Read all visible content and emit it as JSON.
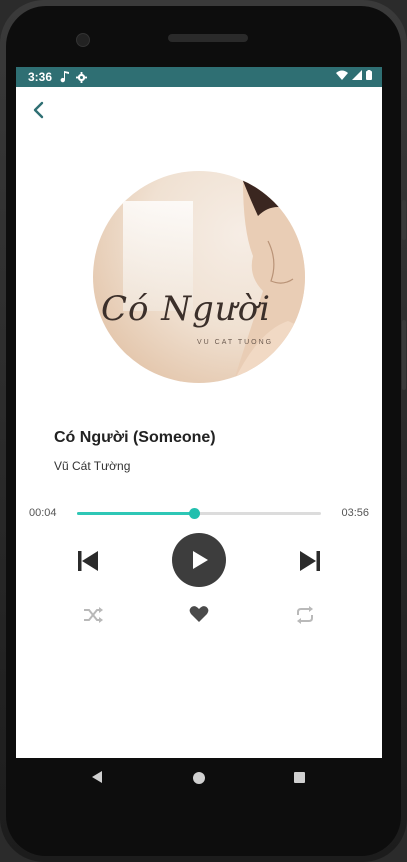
{
  "status_bar": {
    "time": "3:36",
    "left_icons": [
      "music-note-icon",
      "gear-icon"
    ],
    "right_icons": [
      "wifi-icon",
      "signal-icon",
      "battery-icon"
    ],
    "color": "#2f6f73"
  },
  "header": {
    "back_icon": "chevron-left-icon"
  },
  "album": {
    "cover_title": "Có Người",
    "cover_artist": "VU CAT TUONG"
  },
  "song": {
    "title": "Có Người (Someone)",
    "artist": "Vũ Cát Tường"
  },
  "progress": {
    "current": "00:04",
    "total": "03:56",
    "fraction": 0.48,
    "accent_color": "#2ec7b6"
  },
  "controls": {
    "prev_icon": "skip-previous-icon",
    "play_icon": "play-icon",
    "next_icon": "skip-next-icon",
    "shuffle_icon": "shuffle-icon",
    "favorite_icon": "heart-icon",
    "repeat_icon": "repeat-icon"
  },
  "nav_bar": {
    "icons": [
      "nav-back-icon",
      "nav-home-icon",
      "nav-recents-icon"
    ]
  }
}
